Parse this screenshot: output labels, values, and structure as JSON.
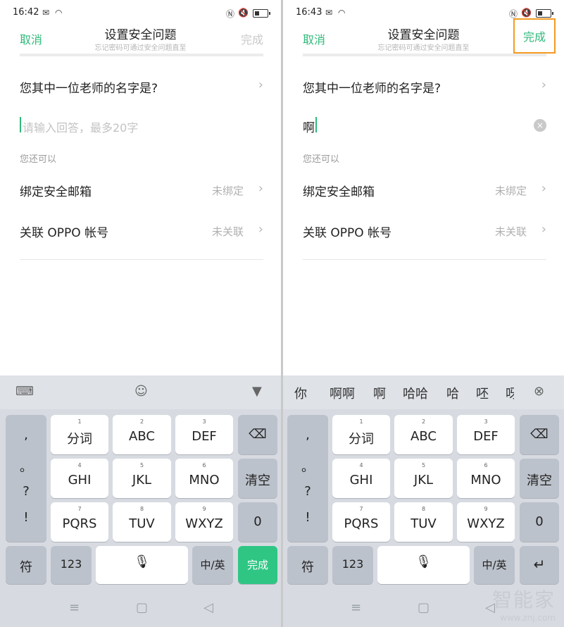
{
  "screens": [
    {
      "status_time": "16:42",
      "header": {
        "cancel": "取消",
        "title": "设置安全问题",
        "subtitle": "忘记密码可通过安全问题直至",
        "done": "完成"
      },
      "question": "您其中一位老师的名字是?",
      "answer_placeholder": "请输入回答，最多20字",
      "answer_value": "",
      "hint": "您还可以",
      "options": [
        {
          "label": "绑定安全邮箱",
          "value": "未绑定"
        },
        {
          "label": "关联 OPPO 帐号",
          "value": "未关联"
        }
      ],
      "keyboard": {
        "punct": [
          ",",
          "。",
          "?",
          "!"
        ],
        "keys": [
          {
            "num": "1",
            "label": "分词"
          },
          {
            "num": "2",
            "label": "ABC"
          },
          {
            "num": "3",
            "label": "DEF"
          },
          {
            "num": "4",
            "label": "GHI"
          },
          {
            "num": "5",
            "label": "JKL"
          },
          {
            "num": "6",
            "label": "MNO"
          },
          {
            "num": "7",
            "label": "PQRS"
          },
          {
            "num": "8",
            "label": "TUV"
          },
          {
            "num": "9",
            "label": "WXYZ"
          }
        ],
        "clear": "清空",
        "zero": "0",
        "fu": "符",
        "num123": "123",
        "lang": "中/英",
        "enter": "完成"
      }
    },
    {
      "status_time": "16:43",
      "header": {
        "cancel": "取消",
        "title": "设置安全问题",
        "subtitle": "忘记密码可通过安全问题直至",
        "done": "完成"
      },
      "question": "您其中一位老师的名字是?",
      "answer_placeholder": "",
      "answer_value": "啊",
      "hint": "您还可以",
      "options": [
        {
          "label": "绑定安全邮箱",
          "value": "未绑定"
        },
        {
          "label": "关联 OPPO 帐号",
          "value": "未关联"
        }
      ],
      "candidates": [
        "你",
        "啊啊",
        "啊",
        "哈哈",
        "哈",
        "呸",
        "呀"
      ],
      "keyboard": {
        "punct": [
          ",",
          "。",
          "?",
          "!"
        ],
        "keys": [
          {
            "num": "1",
            "label": "分词"
          },
          {
            "num": "2",
            "label": "ABC"
          },
          {
            "num": "3",
            "label": "DEF"
          },
          {
            "num": "4",
            "label": "GHI"
          },
          {
            "num": "5",
            "label": "JKL"
          },
          {
            "num": "6",
            "label": "MNO"
          },
          {
            "num": "7",
            "label": "PQRS"
          },
          {
            "num": "8",
            "label": "TUV"
          },
          {
            "num": "9",
            "label": "WXYZ"
          }
        ],
        "clear": "清空",
        "zero": "0",
        "fu": "符",
        "num123": "123",
        "lang": "中/英",
        "enter": "↵"
      }
    }
  ],
  "watermark": {
    "brand": "智能家",
    "url": "www.znj.com"
  },
  "colors": {
    "accent": "#2fb97a",
    "highlight": "#f39a21",
    "keyboard_bg": "#d7dbe1"
  }
}
